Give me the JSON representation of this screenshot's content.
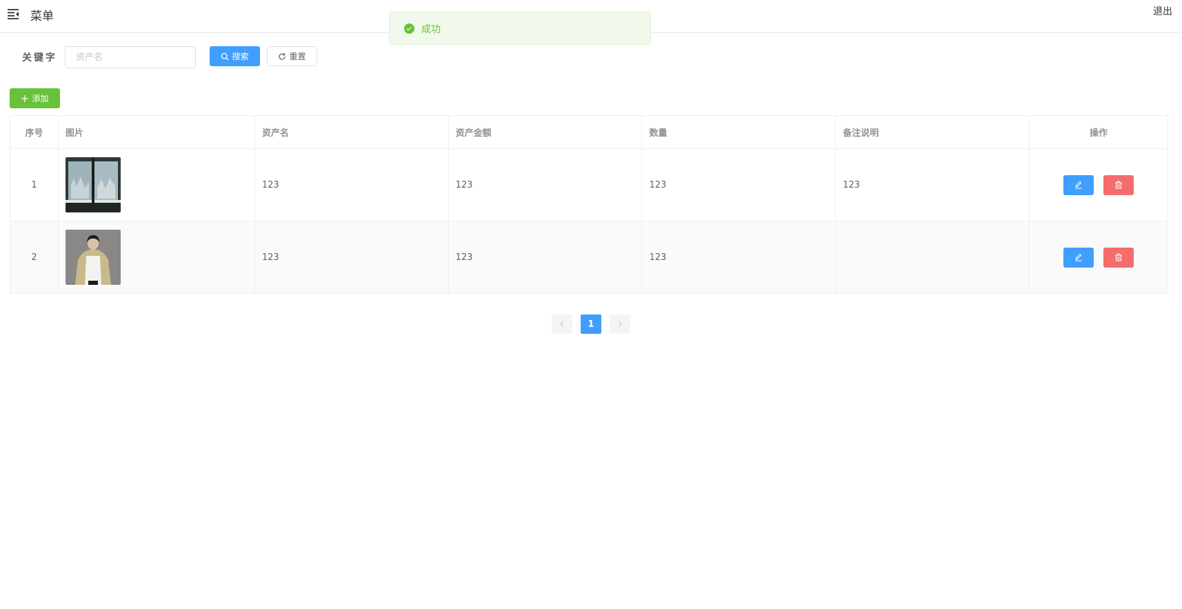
{
  "header": {
    "menu_title": "菜单",
    "logout_label": "退出"
  },
  "toast": {
    "message": "成功",
    "color": "#67c23a"
  },
  "search": {
    "label": "关键字",
    "placeholder": "资产名",
    "value": "",
    "search_label": "搜索",
    "reset_label": "重置"
  },
  "toolbar": {
    "add_label": "添加"
  },
  "table": {
    "columns": [
      "序号",
      "图片",
      "资产名",
      "资产金额",
      "数量",
      "备注说明",
      "操作"
    ],
    "rows": [
      {
        "index": "1",
        "image": "window-photo",
        "name": "123",
        "amount": "123",
        "quantity": "123",
        "remark": "123"
      },
      {
        "index": "2",
        "image": "person-photo",
        "name": "123",
        "amount": "123",
        "quantity": "123",
        "remark": ""
      }
    ]
  },
  "pagination": {
    "current_page": "1"
  },
  "colors": {
    "primary": "#409eff",
    "success": "#67c23a",
    "danger": "#f56c6c"
  },
  "icons": {
    "menu": "menu-fold-icon",
    "search": "search-icon",
    "reset": "refresh-icon",
    "add": "plus-icon",
    "edit": "edit-pencil-icon",
    "delete": "trash-icon",
    "prev": "chevron-left-icon",
    "next": "chevron-right-icon",
    "success": "check-circle-icon"
  }
}
